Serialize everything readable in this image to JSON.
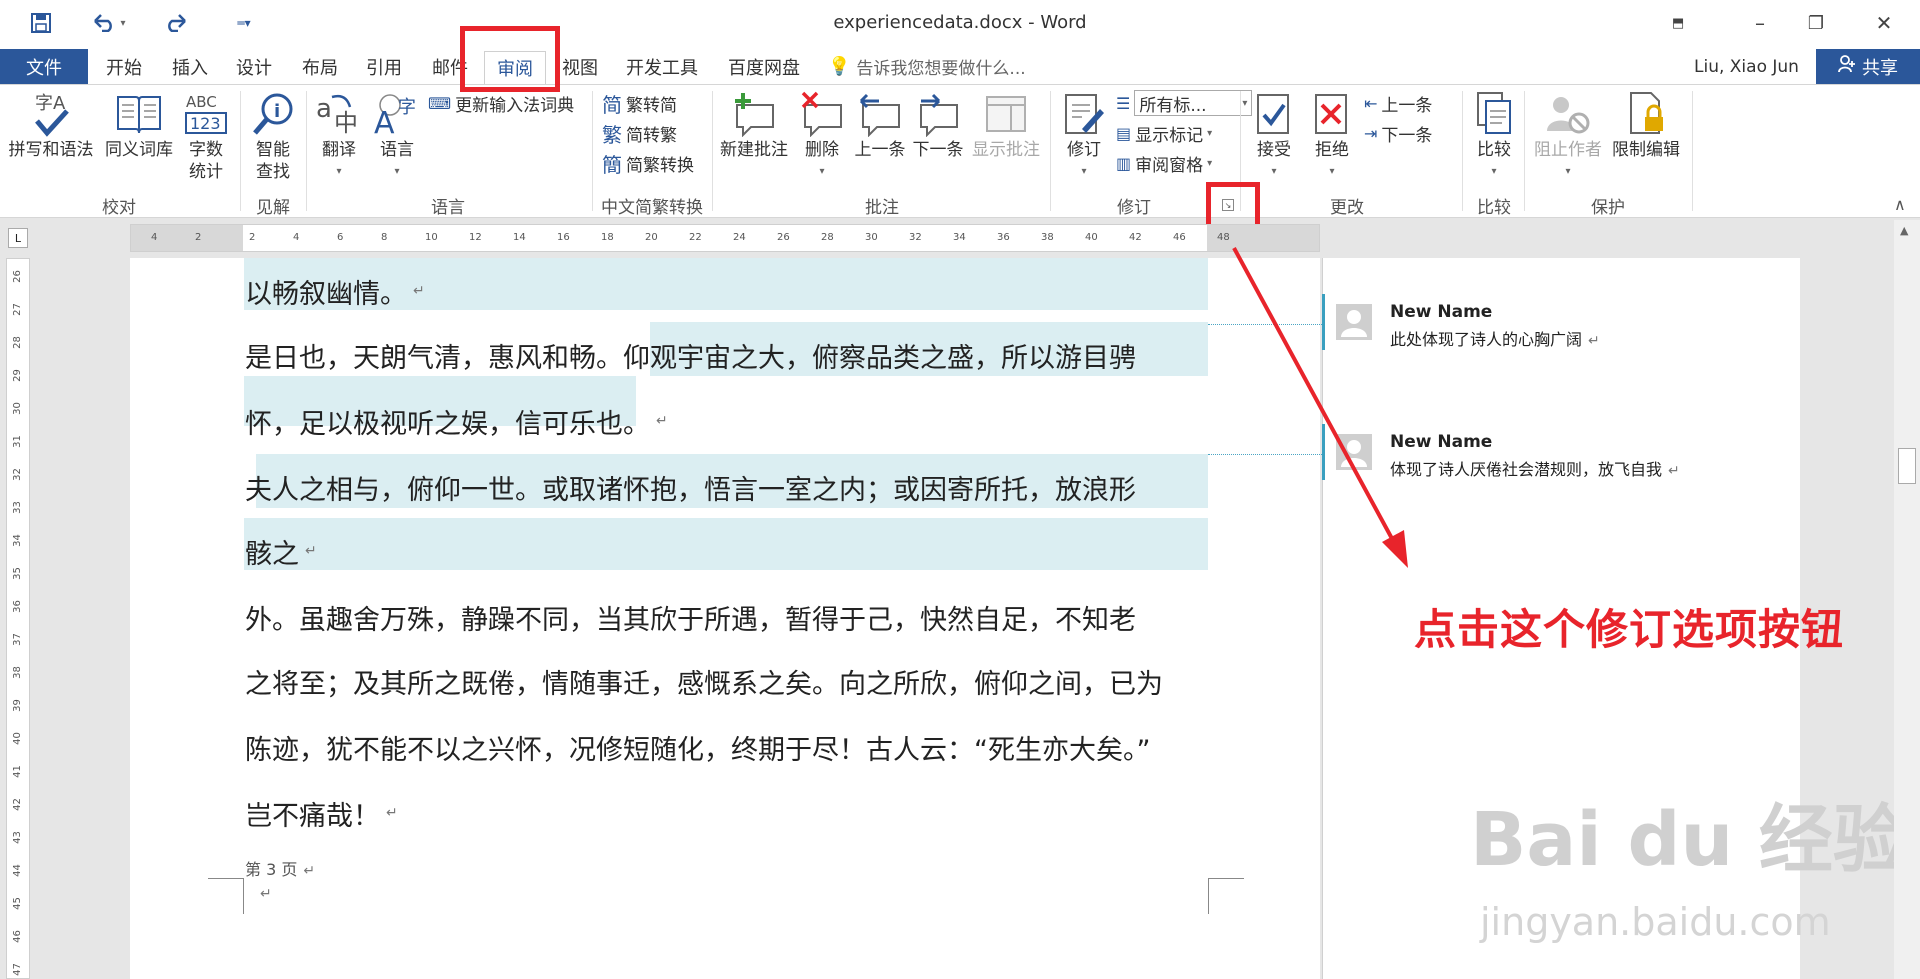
{
  "window": {
    "title": "experiencedata.docx - Word",
    "minimize": "–",
    "restore": "❐",
    "close": "✕",
    "ribbon_display": "⬒"
  },
  "qat": {
    "save_icon": "save-icon",
    "undo_icon": "undo-icon",
    "redo_icon": "redo-icon",
    "customize_icon": "customize-icon"
  },
  "tabs": {
    "file": "文件",
    "items": [
      "开始",
      "插入",
      "设计",
      "布局",
      "引用",
      "邮件",
      "审阅",
      "视图",
      "开发工具",
      "百度网盘"
    ],
    "active": "审阅",
    "tell_me": "告诉我您想要做什么...",
    "user": "Liu, Xiao Jun",
    "share": "共享"
  },
  "ribbon": {
    "proofing": {
      "label": "校对",
      "spelling": "拼写和语法",
      "thesaurus": "同义词库",
      "word_count_1": "字数",
      "word_count_2": "统计"
    },
    "insights": {
      "label": "见解",
      "smart_lookup_1": "智能",
      "smart_lookup_2": "查找"
    },
    "language": {
      "label": "语言",
      "translate": "翻译",
      "language": "语言",
      "update_ime": "更新输入法词典"
    },
    "chinese_conversion": {
      "label": "中文简繁转换",
      "trad_to_simp": "繁转简",
      "simp_to_trad": "简转繁",
      "convert": "简繁转换"
    },
    "comments": {
      "label": "批注",
      "new": "新建批注",
      "delete": "删除",
      "previous": "上一条",
      "next": "下一条",
      "show": "显示批注"
    },
    "tracking": {
      "label": "修订",
      "track_changes": "修订",
      "markup_select": "所有标...",
      "show_markup": "显示标记",
      "reviewing_pane": "审阅窗格"
    },
    "changes": {
      "label": "更改",
      "accept": "接受",
      "reject": "拒绝",
      "previous": "上一条",
      "next": "下一条"
    },
    "compare": {
      "label": "比较",
      "compare": "比较"
    },
    "protect": {
      "label": "保护",
      "block_authors": "阻止作者",
      "restrict_editing": "限制编辑"
    }
  },
  "ruler": {
    "h_ticks": [
      "4",
      "2",
      "2",
      "4",
      "6",
      "8",
      "10",
      "12",
      "14",
      "16",
      "18",
      "20",
      "22",
      "24",
      "26",
      "28",
      "30",
      "32",
      "34",
      "36",
      "38",
      "40",
      "42",
      "46",
      "48"
    ],
    "v_ticks": [
      "26",
      "27",
      "28",
      "29",
      "30",
      "31",
      "32",
      "33",
      "34",
      "35",
      "36",
      "37",
      "38",
      "39",
      "40",
      "41",
      "42",
      "43",
      "44",
      "45",
      "46",
      "47"
    ]
  },
  "document": {
    "lines": [
      "以畅叙幽情。",
      " 是日也，天朗气清，惠风和畅。仰观宇宙之大，俯察品类之盛，所以游目骋",
      "怀，足以极视听之娱，信可乐也。",
      " 夫人之相与，俯仰一世。或取诸怀抱，悟言一室之内；或因寄所托，放浪形",
      "骸之",
      " 外。虽趣舍万殊，静躁不同，当其欣于所遇，暂得于己，快然自足，不知老",
      "之将至；及其所之既倦，情随事迁，感慨系之矣。向之所欣，俯仰之间，已为",
      "陈迹，犹不能不以之兴怀，况修短随化，终期于尽！古人云：“死生亦大矣。”",
      "岂不痛哉！"
    ],
    "pilcrow": "↵",
    "footer": "第 3 页"
  },
  "comments": [
    {
      "author": "New Name",
      "text": "此处体现了诗人的心胸广阔"
    },
    {
      "author": "New Name",
      "text": "体现了诗人厌倦社会潜规则，放飞自我"
    }
  ],
  "annotation": {
    "instruction": "点击这个修订选项按钮",
    "color": "#e8242b"
  },
  "watermark": {
    "logo": "Bai du 经验",
    "url": "jingyan.baidu.com"
  },
  "colors": {
    "accent": "#2b579a",
    "highlight": "#e8242b",
    "comment_shade": "#dbeef2"
  }
}
